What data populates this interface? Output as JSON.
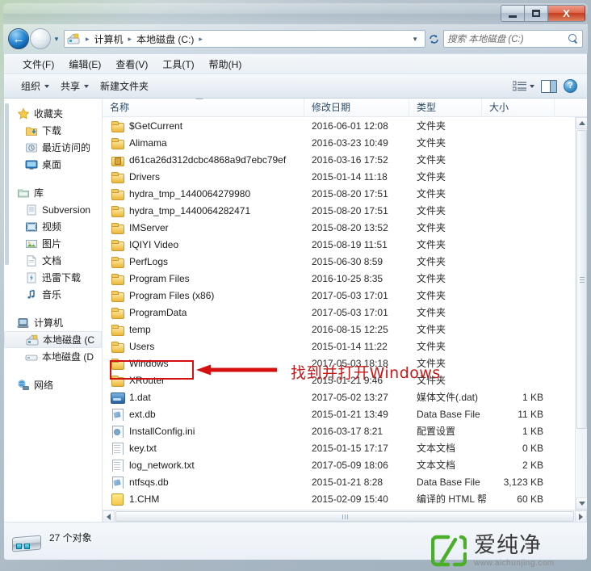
{
  "window": {
    "controls": {
      "minimize": "–",
      "maximize": "□",
      "close": "X"
    }
  },
  "nav": {
    "back_label": "←",
    "forward_label": "→",
    "history_caret": "▼",
    "refresh_label": "↻",
    "breadcrumbs": [
      "计算机",
      "本地磁盘 (C:)"
    ],
    "separator": "▸",
    "address_caret": "▼"
  },
  "search": {
    "placeholder": "搜索 本地磁盘 (C:)",
    "value": ""
  },
  "menubar": {
    "items": [
      {
        "label": "文件(F)"
      },
      {
        "label": "编辑(E)"
      },
      {
        "label": "查看(V)"
      },
      {
        "label": "工具(T)"
      },
      {
        "label": "帮助(H)"
      }
    ]
  },
  "commandbar": {
    "items": [
      {
        "label": "组织",
        "has_caret": true
      },
      {
        "label": "共享",
        "has_caret": true
      },
      {
        "label": "新建文件夹",
        "has_caret": false
      }
    ],
    "help_label": "?"
  },
  "sidebar": {
    "groups": [
      {
        "header": {
          "label": "收藏夹",
          "icon": "star-icon"
        },
        "items": [
          {
            "label": "下载",
            "icon": "downloads-icon"
          },
          {
            "label": "最近访问的",
            "icon": "recent-places-icon"
          },
          {
            "label": "桌面",
            "icon": "desktop-icon"
          }
        ]
      },
      {
        "header": {
          "label": "库",
          "icon": "library-icon"
        },
        "items": [
          {
            "label": "Subversion",
            "icon": "document-icon"
          },
          {
            "label": "视频",
            "icon": "video-icon"
          },
          {
            "label": "图片",
            "icon": "pictures-icon"
          },
          {
            "label": "文档",
            "icon": "documents-icon"
          },
          {
            "label": "迅雷下载",
            "icon": "thunder-download-icon"
          },
          {
            "label": "音乐",
            "icon": "music-icon"
          }
        ]
      },
      {
        "header": {
          "label": "计算机",
          "icon": "computer-icon"
        },
        "items": [
          {
            "label": "本地磁盘 (C",
            "icon": "system-drive-icon",
            "selected": true
          },
          {
            "label": "本地磁盘 (D",
            "icon": "drive-icon",
            "selected": false
          }
        ]
      },
      {
        "header": {
          "label": "网络",
          "icon": "network-icon"
        },
        "items": []
      }
    ]
  },
  "filelist": {
    "columns": [
      {
        "key": "name",
        "label": "名称",
        "sorted": true
      },
      {
        "key": "date",
        "label": "修改日期",
        "sorted": false
      },
      {
        "key": "type",
        "label": "类型",
        "sorted": false
      },
      {
        "key": "size",
        "label": "大小",
        "sorted": false
      }
    ],
    "rows": [
      {
        "name": "$GetCurrent",
        "date": "2016-06-01 12:08",
        "type": "文件夹",
        "size": "",
        "icon": "folder-icon"
      },
      {
        "name": "Alimama",
        "date": "2016-03-23 10:49",
        "type": "文件夹",
        "size": "",
        "icon": "folder-icon"
      },
      {
        "name": "d61ca26d312dcbc4868a9d7ebc79ef",
        "date": "2016-03-16 17:52",
        "type": "文件夹",
        "size": "",
        "icon": "folder-lock-icon"
      },
      {
        "name": "Drivers",
        "date": "2015-01-14 11:18",
        "type": "文件夹",
        "size": "",
        "icon": "folder-icon"
      },
      {
        "name": "hydra_tmp_1440064279980",
        "date": "2015-08-20 17:51",
        "type": "文件夹",
        "size": "",
        "icon": "folder-icon"
      },
      {
        "name": "hydra_tmp_1440064282471",
        "date": "2015-08-20 17:51",
        "type": "文件夹",
        "size": "",
        "icon": "folder-icon"
      },
      {
        "name": "IMServer",
        "date": "2015-08-20 13:52",
        "type": "文件夹",
        "size": "",
        "icon": "folder-icon"
      },
      {
        "name": "IQIYI Video",
        "date": "2015-08-19 11:51",
        "type": "文件夹",
        "size": "",
        "icon": "folder-icon"
      },
      {
        "name": "PerfLogs",
        "date": "2015-06-30 8:59",
        "type": "文件夹",
        "size": "",
        "icon": "folder-icon"
      },
      {
        "name": "Program Files",
        "date": "2016-10-25 8:35",
        "type": "文件夹",
        "size": "",
        "icon": "folder-icon"
      },
      {
        "name": "Program Files (x86)",
        "date": "2017-05-03 17:01",
        "type": "文件夹",
        "size": "",
        "icon": "folder-icon"
      },
      {
        "name": "ProgramData",
        "date": "2017-05-03 17:01",
        "type": "文件夹",
        "size": "",
        "icon": "folder-icon"
      },
      {
        "name": "temp",
        "date": "2016-08-15 12:25",
        "type": "文件夹",
        "size": "",
        "icon": "folder-icon"
      },
      {
        "name": "Users",
        "date": "2015-01-14 11:22",
        "type": "文件夹",
        "size": "",
        "icon": "folder-icon"
      },
      {
        "name": "Windows",
        "date": "2017-05-03 18:18",
        "type": "文件夹",
        "size": "",
        "icon": "folder-icon",
        "highlighted": true
      },
      {
        "name": "XRouter",
        "date": "2015-01-21 9:46",
        "type": "文件夹",
        "size": "",
        "icon": "folder-icon"
      },
      {
        "name": "1.dat",
        "date": "2017-05-02 13:27",
        "type": "媒体文件(.dat)",
        "size": "1 KB",
        "icon": "media-file-icon"
      },
      {
        "name": "ext.db",
        "date": "2015-01-21 13:49",
        "type": "Data Base File",
        "size": "11 KB",
        "icon": "database-file-icon"
      },
      {
        "name": "InstallConfig.ini",
        "date": "2016-03-17 8:21",
        "type": "配置设置",
        "size": "1 KB",
        "icon": "ini-file-icon"
      },
      {
        "name": "key.txt",
        "date": "2015-01-15 17:17",
        "type": "文本文档",
        "size": "0 KB",
        "icon": "text-file-icon"
      },
      {
        "name": "log_network.txt",
        "date": "2017-05-09 18:06",
        "type": "文本文档",
        "size": "2 KB",
        "icon": "text-file-icon"
      },
      {
        "name": "ntfsqs.db",
        "date": "2015-01-21 8:28",
        "type": "Data Base File",
        "size": "3,123 KB",
        "icon": "database-file-icon"
      },
      {
        "name": "1.CHM",
        "date": "2015-02-09 15:40",
        "type": "编译的 HTML 帮",
        "size": "60 KB",
        "icon": "html-help-icon"
      }
    ]
  },
  "statusbar": {
    "text": "27 个对象"
  },
  "annotation": {
    "text": "找到并打开Windows",
    "color": "#c81818",
    "target_row": "Windows"
  },
  "watermark": {
    "name": "爱纯净",
    "url": "www.aichunjing.com",
    "color": "#4caf2a"
  }
}
